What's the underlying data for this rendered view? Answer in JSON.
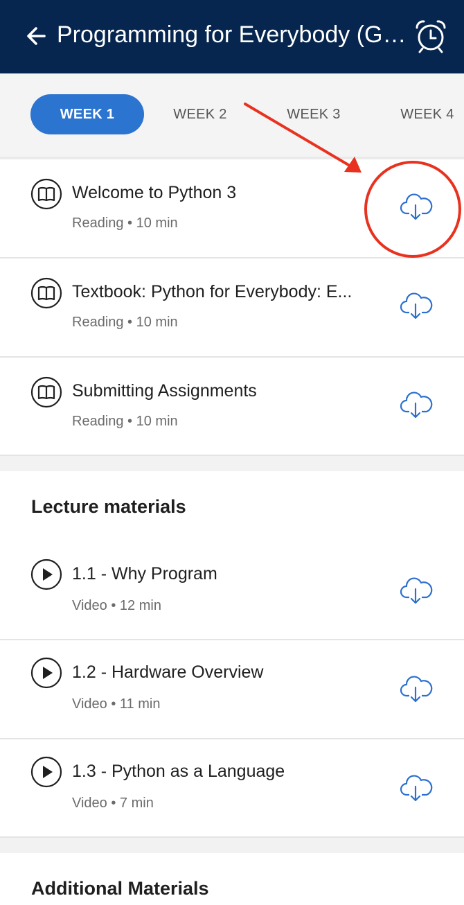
{
  "header": {
    "title": "Programming for Everybody (Get...",
    "back_icon": "arrow-left-icon",
    "alarm_icon": "alarm-clock-icon"
  },
  "tabs": [
    {
      "label": "WEEK 1",
      "active": true
    },
    {
      "label": "WEEK 2",
      "active": false
    },
    {
      "label": "WEEK 3",
      "active": false
    },
    {
      "label": "WEEK 4",
      "active": false
    }
  ],
  "readings": [
    {
      "title": "Welcome to Python 3",
      "meta": "Reading • 10 min",
      "icon": "book-icon"
    },
    {
      "title": "Textbook: Python for Everybody: E...",
      "meta": "Reading • 10 min",
      "icon": "book-icon"
    },
    {
      "title": "Submitting Assignments",
      "meta": "Reading • 10 min",
      "icon": "book-icon"
    }
  ],
  "lecture_section": {
    "title": "Lecture materials",
    "items": [
      {
        "title": "1.1 - Why Program",
        "meta": "Video • 12 min",
        "icon": "play-icon"
      },
      {
        "title": "1.2 - Hardware Overview",
        "meta": "Video • 11 min",
        "icon": "play-icon"
      },
      {
        "title": "1.3 - Python as a Language",
        "meta": "Video • 7 min",
        "icon": "play-icon"
      }
    ]
  },
  "additional_section": {
    "title": "Additional Materials"
  },
  "colors": {
    "appbar": "#07264f",
    "accent": "#2b74d0",
    "download_icon": "#2b6fd0",
    "annotation": "#e8321f"
  }
}
